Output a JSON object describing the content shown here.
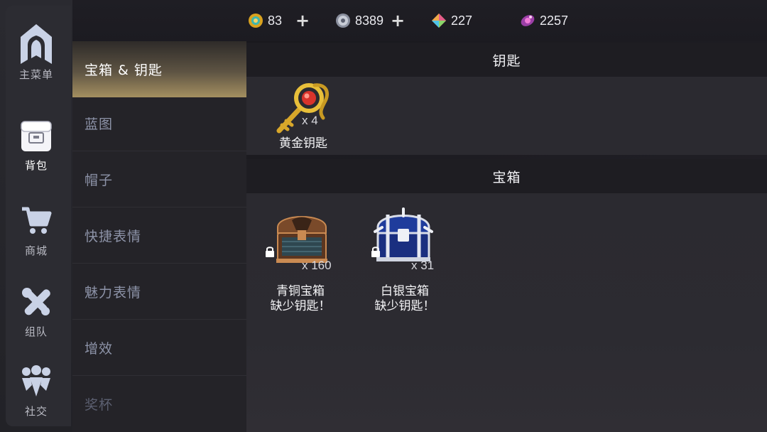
{
  "currencies": [
    {
      "icon": "gold-coin-icon",
      "value": "83",
      "has_plus": true
    },
    {
      "icon": "silver-gear-coin-icon",
      "value": "8389",
      "has_plus": true
    },
    {
      "icon": "rainbow-gem-icon",
      "value": "227",
      "has_plus": false
    },
    {
      "icon": "nebula-crystal-icon",
      "value": "2257",
      "has_plus": false
    }
  ],
  "nav": [
    {
      "label": "主菜单",
      "icon": "castle-crest-icon",
      "active": false
    },
    {
      "label": "背包",
      "icon": "backpack-icon",
      "active": true
    },
    {
      "label": "商城",
      "icon": "shopping-cart-icon",
      "active": false
    },
    {
      "label": "组队",
      "icon": "crossed-tools-icon",
      "active": false
    },
    {
      "label": "社交",
      "icon": "people-icon",
      "active": false
    }
  ],
  "categories": [
    {
      "label": "宝箱 & 钥匙",
      "active": true
    },
    {
      "label": "蓝图",
      "active": false
    },
    {
      "label": "帽子",
      "active": false
    },
    {
      "label": "快捷表情",
      "active": false
    },
    {
      "label": "魅力表情",
      "active": false
    },
    {
      "label": "增效",
      "active": false
    },
    {
      "label": "奖杯",
      "active": false
    }
  ],
  "keys_section": {
    "title": "钥匙",
    "items": [
      {
        "name": "黄金钥匙",
        "qty": "x 4",
        "icon": "golden-key-icon"
      }
    ]
  },
  "chests_section": {
    "title": "宝箱",
    "items": [
      {
        "name": "青铜宝箱",
        "status": "缺少钥匙！",
        "qty": "x 160",
        "icon": "bronze-chest-icon",
        "locked": true
      },
      {
        "name": "白银宝箱",
        "status": "缺少钥匙！",
        "qty": "x 31",
        "icon": "silver-chest-icon",
        "locked": true
      }
    ]
  },
  "colors": {
    "active_category": "#a48f60",
    "panel": "#2b2a30",
    "header": "#1e1d22"
  }
}
